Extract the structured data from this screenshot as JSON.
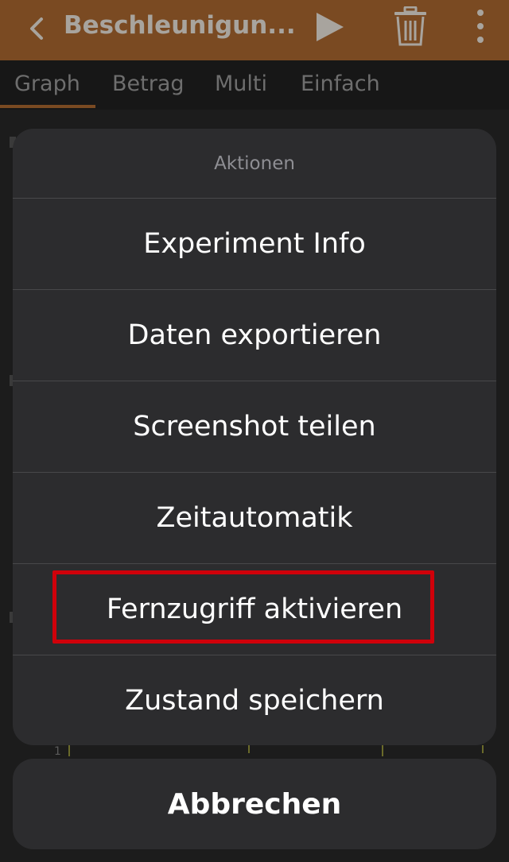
{
  "appbar": {
    "title": "Beschleunigun...",
    "icons": [
      "back-chevron-icon",
      "play-icon",
      "trash-icon",
      "more-vertical-icon"
    ]
  },
  "tabs": [
    {
      "label": "Graph",
      "active": true
    },
    {
      "label": "Betrag",
      "active": false
    },
    {
      "label": "Multi",
      "active": false
    },
    {
      "label": "Einfach",
      "active": false
    }
  ],
  "background": {
    "axis_fragment": "1"
  },
  "sheet": {
    "title": "Aktionen",
    "actions": [
      {
        "label": "Experiment Info"
      },
      {
        "label": "Daten exportieren"
      },
      {
        "label": "Screenshot teilen"
      },
      {
        "label": "Zeitautomatik"
      },
      {
        "label": "Fernzugriff aktivieren",
        "highlighted": true
      },
      {
        "label": "Zustand speichern"
      }
    ],
    "cancel_label": "Abbrechen",
    "highlight_color": "#d0000a"
  },
  "colors": {
    "appbar": "#7a4a22",
    "sheet_bg": "#2c2c2e",
    "text": "#ffffff",
    "muted_text": "#8e8e93"
  }
}
